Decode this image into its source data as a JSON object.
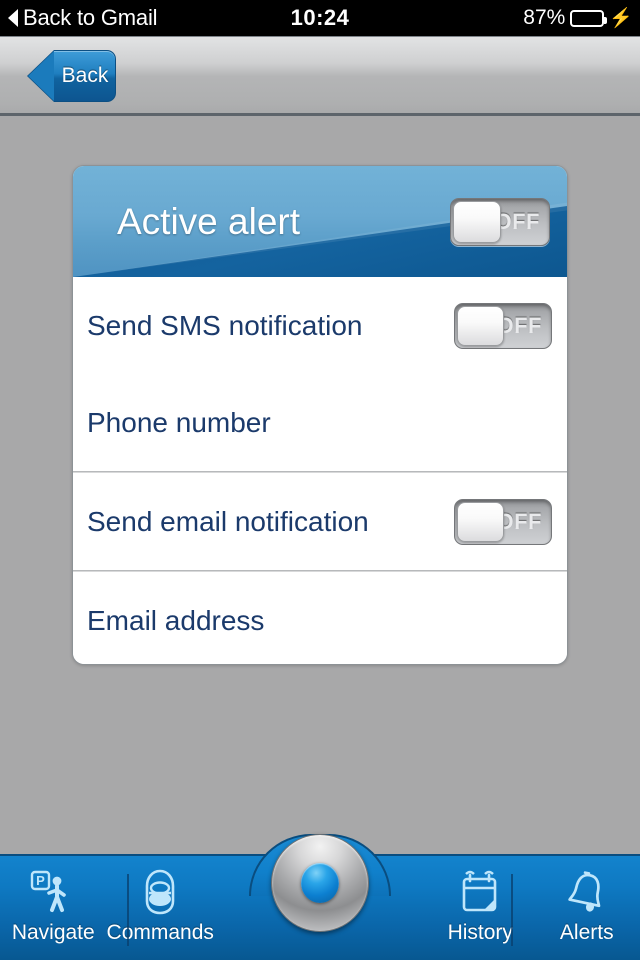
{
  "status_bar": {
    "back_label": "Back to Gmail",
    "time": "10:24",
    "battery_percent": "87%",
    "battery_level": 87,
    "charging_icon": "⚡",
    "battery_color": "#4cd964"
  },
  "nav_bar": {
    "back_label": "Back"
  },
  "card": {
    "header": {
      "title": "Active alert",
      "toggle_label": "OFF",
      "toggle_state": "off"
    },
    "rows": [
      {
        "label": "Send SMS notification",
        "toggle_label": "OFF",
        "toggle_state": "off",
        "has_toggle": true
      },
      {
        "label": "Phone number",
        "has_toggle": false
      },
      {
        "label": "Send email notification",
        "toggle_label": "OFF",
        "toggle_state": "off",
        "has_toggle": true
      },
      {
        "label": "Email address",
        "has_toggle": false
      }
    ]
  },
  "tab_bar": {
    "tabs": [
      {
        "label": "Navigate",
        "icon": "parking-walking-person-icon"
      },
      {
        "label": "Commands",
        "icon": "car-key-remote-icon"
      },
      {
        "label": "History",
        "icon": "calendar-icon"
      },
      {
        "label": "Alerts",
        "icon": "bell-icon"
      }
    ],
    "center_button": "locate-vehicle-button"
  },
  "colors": {
    "accent_blue": "#0e79c2",
    "header_blue": "#5b9ec9",
    "header_swoosh": "#0f5a96",
    "label_navy": "#1b3a6b",
    "page_background": "#a8a8a9"
  }
}
